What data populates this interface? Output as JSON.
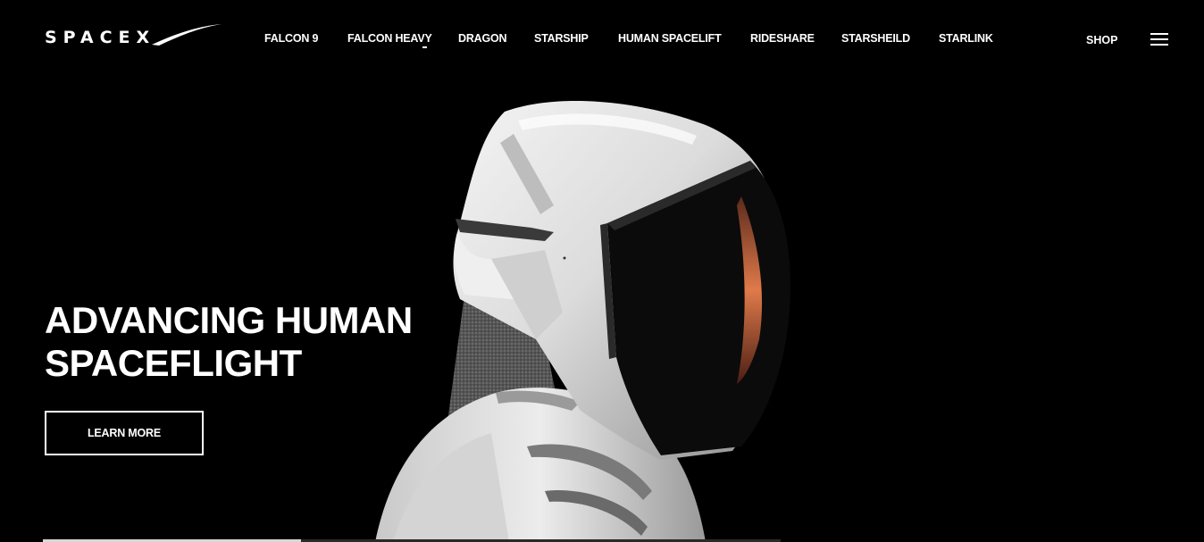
{
  "logo": {
    "text": "SPACEX"
  },
  "nav": {
    "items": [
      {
        "label": "FALCON 9"
      },
      {
        "label": "FALCON HEAVY"
      },
      {
        "label": "DRAGON"
      },
      {
        "label": "STARSHIP"
      },
      {
        "label": "HUMAN SPACELIFT"
      },
      {
        "label": "RIDESHARE"
      },
      {
        "label": "STARSHEILD"
      },
      {
        "label": "STARLINK"
      }
    ],
    "shop_label": "SHOP",
    "menu_icon": "hamburger-menu-icon"
  },
  "hero": {
    "title_line1": "ADVANCING HUMAN",
    "title_line2": "SPACEFLIGHT",
    "cta_label": "LEARN MORE"
  },
  "progress": {
    "fill_fraction": 0.35
  },
  "colors": {
    "background": "#000000",
    "text": "#ffffff",
    "helmet": "#e8e8e8",
    "visor_reflection": "#e07a4a",
    "suit_fabric": "#5a5a5a"
  }
}
